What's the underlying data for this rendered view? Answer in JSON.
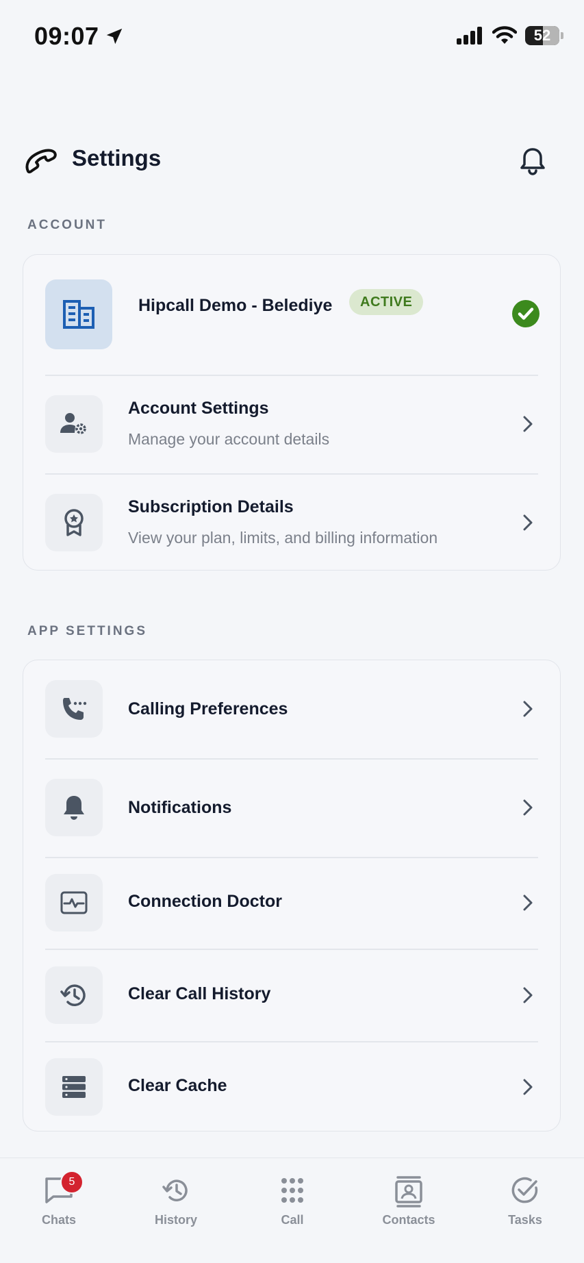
{
  "status_bar": {
    "time": "09:07",
    "battery": "52"
  },
  "header": {
    "title": "Settings"
  },
  "account_section": {
    "label": "ACCOUNT",
    "account": {
      "name": "Hipcall Demo - Belediye",
      "status": "ACTIVE"
    },
    "items": [
      {
        "title": "Account Settings",
        "subtitle": "Manage your account details"
      },
      {
        "title": "Subscription Details",
        "subtitle": "View your plan, limits, and billing information"
      }
    ]
  },
  "app_section": {
    "label": "APP SETTINGS",
    "items": [
      {
        "title": "Calling Preferences"
      },
      {
        "title": "Notifications"
      },
      {
        "title": "Connection Doctor"
      },
      {
        "title": "Clear Call History"
      },
      {
        "title": "Clear Cache"
      }
    ]
  },
  "tabbar": {
    "chats": {
      "label": "Chats",
      "badge": "5"
    },
    "history": {
      "label": "History"
    },
    "call": {
      "label": "Call"
    },
    "contacts": {
      "label": "Contacts"
    },
    "tasks": {
      "label": "Tasks"
    }
  },
  "colors": {
    "accent_active_bg": "#dbe8cf",
    "accent_active_text": "#3f7a1d",
    "check_green": "#3c8a1d",
    "badge_red": "#d3232f"
  }
}
